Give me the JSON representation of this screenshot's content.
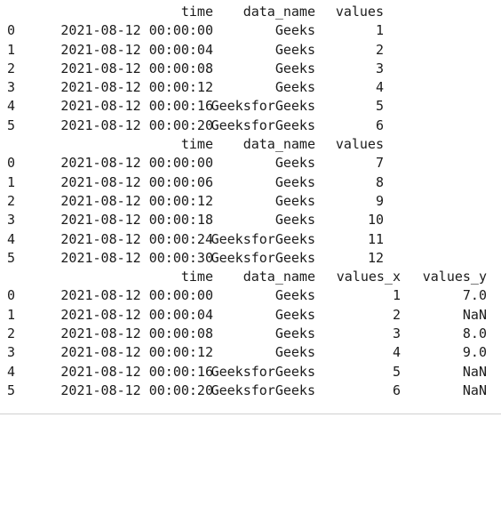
{
  "tables": [
    {
      "columns": [
        "time",
        "data_name",
        "values"
      ],
      "rows": [
        {
          "index": "0",
          "time": "2021-08-12 00:00:00",
          "data_name": "Geeks",
          "values": "1"
        },
        {
          "index": "1",
          "time": "2021-08-12 00:00:04",
          "data_name": "Geeks",
          "values": "2"
        },
        {
          "index": "2",
          "time": "2021-08-12 00:00:08",
          "data_name": "Geeks",
          "values": "3"
        },
        {
          "index": "3",
          "time": "2021-08-12 00:00:12",
          "data_name": "Geeks",
          "values": "4"
        },
        {
          "index": "4",
          "time": "2021-08-12 00:00:16",
          "data_name": "GeeksforGeeks",
          "values": "5"
        },
        {
          "index": "5",
          "time": "2021-08-12 00:00:20",
          "data_name": "GeeksforGeeks",
          "values": "6"
        }
      ]
    },
    {
      "columns": [
        "time",
        "data_name",
        "values"
      ],
      "rows": [
        {
          "index": "0",
          "time": "2021-08-12 00:00:00",
          "data_name": "Geeks",
          "values": "7"
        },
        {
          "index": "1",
          "time": "2021-08-12 00:00:06",
          "data_name": "Geeks",
          "values": "8"
        },
        {
          "index": "2",
          "time": "2021-08-12 00:00:12",
          "data_name": "Geeks",
          "values": "9"
        },
        {
          "index": "3",
          "time": "2021-08-12 00:00:18",
          "data_name": "Geeks",
          "values": "10"
        },
        {
          "index": "4",
          "time": "2021-08-12 00:00:24",
          "data_name": "GeeksforGeeks",
          "values": "11"
        },
        {
          "index": "5",
          "time": "2021-08-12 00:00:30",
          "data_name": "GeeksforGeeks",
          "values": "12"
        }
      ]
    },
    {
      "columns": [
        "time",
        "data_name",
        "values_x",
        "values_y"
      ],
      "rows": [
        {
          "index": "0",
          "time": "2021-08-12 00:00:00",
          "data_name": "Geeks",
          "values_x": "1",
          "values_y": "7.0"
        },
        {
          "index": "1",
          "time": "2021-08-12 00:00:04",
          "data_name": "Geeks",
          "values_x": "2",
          "values_y": "NaN"
        },
        {
          "index": "2",
          "time": "2021-08-12 00:00:08",
          "data_name": "Geeks",
          "values_x": "3",
          "values_y": "8.0"
        },
        {
          "index": "3",
          "time": "2021-08-12 00:00:12",
          "data_name": "Geeks",
          "values_x": "4",
          "values_y": "9.0"
        },
        {
          "index": "4",
          "time": "2021-08-12 00:00:16",
          "data_name": "GeeksforGeeks",
          "values_x": "5",
          "values_y": "NaN"
        },
        {
          "index": "5",
          "time": "2021-08-12 00:00:20",
          "data_name": "GeeksforGeeks",
          "values_x": "6",
          "values_y": "NaN"
        }
      ]
    }
  ]
}
